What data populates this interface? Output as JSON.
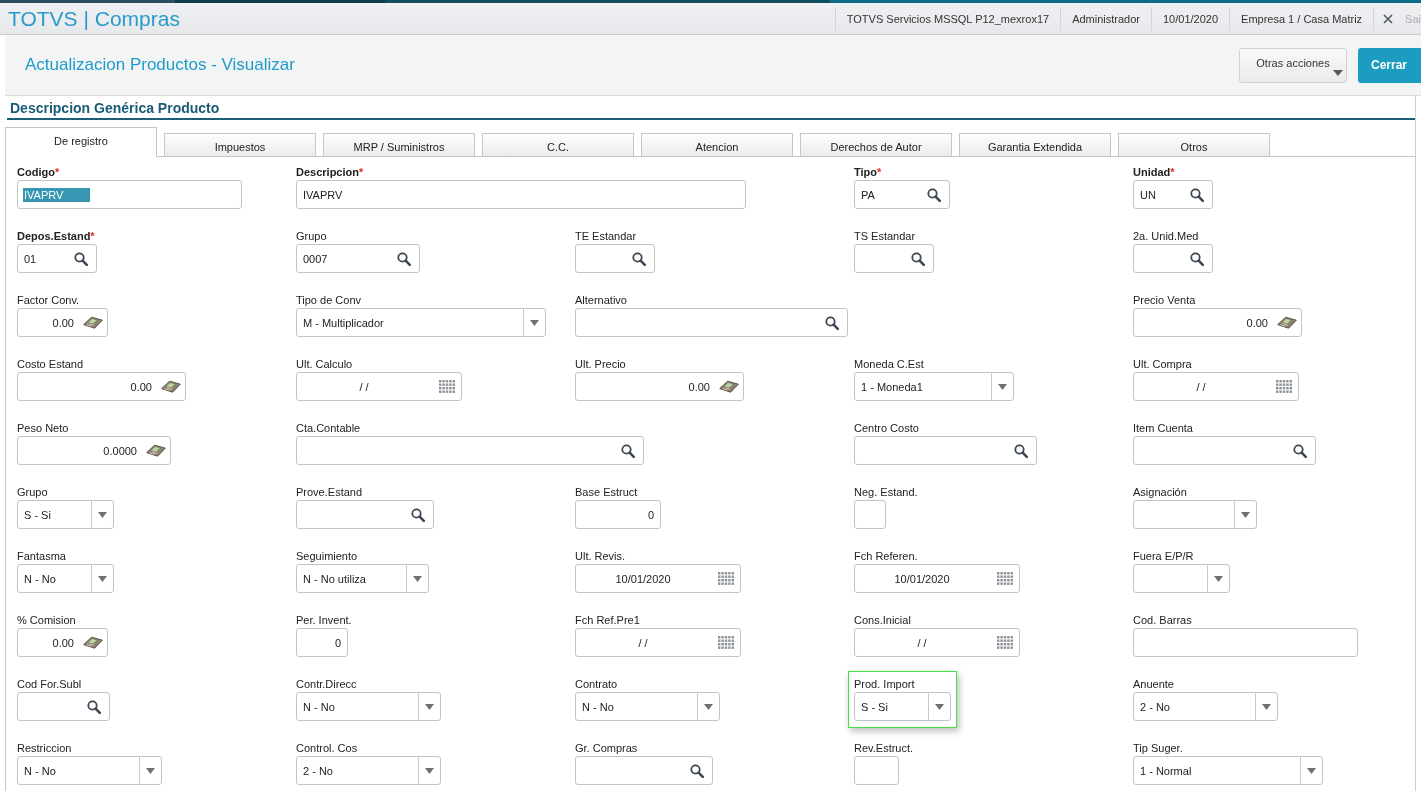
{
  "header": {
    "app_title": "TOTVS | Compras",
    "info": [
      "TOTVS Servicios MSSQL P12_mexrox17",
      "Administrador",
      "10/01/2020",
      "Empresa 1 / Casa Matriz"
    ],
    "exit_label": "Sai"
  },
  "toolbar": {
    "title": "Actualizacion Productos - Visualizar",
    "actions": [
      {
        "label": "Otras acciones",
        "kind": "menu"
      },
      {
        "label": "Cerrar",
        "kind": "primary"
      }
    ]
  },
  "section_title": "Descripcion Genérica Producto",
  "tabs": [
    {
      "label": "De registro",
      "selected": true
    },
    {
      "label": "Impuestos",
      "selected": false
    },
    {
      "label": "MRP / Suministros",
      "selected": false
    },
    {
      "label": "C.C.",
      "selected": false
    },
    {
      "label": "Atencion",
      "selected": false
    },
    {
      "label": "Derechos de Autor",
      "selected": false
    },
    {
      "label": "Garantia Extendida",
      "selected": false
    },
    {
      "label": "Otros",
      "selected": false
    }
  ],
  "form": {
    "rows": [
      [
        {
          "label": "Codigo",
          "required": true,
          "mark": "*",
          "kind": "text",
          "value": "IVAPRV",
          "value_selected": true,
          "focused": false
        },
        {
          "label": "Descripcion",
          "required": true,
          "mark": "*",
          "kind": "text",
          "value": "IVAPRV",
          "value_selected": false,
          "focused": false
        },
        null,
        {
          "label": "Tipo",
          "required": true,
          "mark": "*",
          "kind": "lookup",
          "value": "PA",
          "value_selected": false,
          "focused": false
        },
        {
          "label": "Unidad",
          "required": true,
          "mark": "*",
          "kind": "lookup",
          "value": "UN",
          "value_selected": false,
          "focused": false
        }
      ],
      [
        {
          "label": "Depos.Estand",
          "required": true,
          "mark": "*",
          "kind": "lookup",
          "value": "01",
          "value_selected": false,
          "focused": false
        },
        {
          "label": "Grupo",
          "required": false,
          "kind": "lookup",
          "value": "0007",
          "value_selected": false,
          "focused": false
        },
        {
          "label": "TE Estandar",
          "required": false,
          "kind": "lookup",
          "value_selected": false,
          "focused": false
        },
        {
          "label": "TS Estandar",
          "required": false,
          "kind": "lookup",
          "value_selected": false,
          "focused": false
        },
        {
          "label": "2a. Unid.Med",
          "required": false,
          "kind": "lookup",
          "value_selected": false,
          "focused": false
        }
      ],
      [
        {
          "label": "Factor Conv.",
          "required": false,
          "kind": "numeric",
          "value": "0.00",
          "value_selected": false,
          "focused": false
        },
        {
          "label": "Tipo de Conv",
          "required": false,
          "kind": "select",
          "value": "M - Multiplicador",
          "value_selected": false,
          "focused": false
        },
        {
          "label": "Alternativo",
          "required": false,
          "kind": "lookup",
          "value_selected": false,
          "focused": false
        },
        null,
        {
          "label": "Precio Venta",
          "required": false,
          "kind": "numeric",
          "value": "0.00",
          "value_selected": false,
          "focused": false
        }
      ],
      [
        {
          "label": "Costo Estand",
          "required": false,
          "kind": "numeric",
          "value": "0.00",
          "value_selected": false,
          "focused": false
        },
        {
          "label": "Ult. Calculo",
          "required": false,
          "kind": "date",
          "value": "/ /",
          "value_selected": false,
          "focused": false
        },
        {
          "label": "Ult. Precio",
          "required": false,
          "kind": "numeric",
          "value": "0.00",
          "value_selected": false,
          "focused": false
        },
        {
          "label": "Moneda C.Est",
          "required": false,
          "kind": "select",
          "value": "1 - Moneda1",
          "value_selected": false,
          "focused": false
        },
        {
          "label": "Ult. Compra",
          "required": false,
          "kind": "date",
          "value": "/ /",
          "value_selected": false,
          "focused": false
        }
      ],
      [
        {
          "label": "Peso Neto",
          "required": false,
          "kind": "numeric",
          "value": "0.0000",
          "value_selected": false,
          "focused": false
        },
        {
          "label": "Cta.Contable",
          "required": false,
          "kind": "lookup",
          "value_selected": false,
          "focused": false
        },
        null,
        {
          "label": "Centro Costo",
          "required": false,
          "kind": "lookup",
          "value_selected": false,
          "focused": false
        },
        {
          "label": "Item Cuenta",
          "required": false,
          "kind": "lookup",
          "value_selected": false,
          "focused": false
        }
      ],
      [
        {
          "label": "Grupo",
          "required": false,
          "kind": "select",
          "value": "S - Si",
          "value_selected": false,
          "focused": false
        },
        {
          "label": "Prove.Estand",
          "required": false,
          "kind": "lookup",
          "value_selected": false,
          "focused": false
        },
        {
          "label": "Base Estruct",
          "required": false,
          "kind": "number",
          "value": "0",
          "value_selected": false,
          "focused": false
        },
        {
          "label": "Neg. Estand.",
          "required": false,
          "kind": "text",
          "value_selected": false,
          "focused": false
        },
        {
          "label": "Asignación",
          "required": false,
          "kind": "select",
          "value_selected": false,
          "focused": false
        }
      ],
      [
        {
          "label": "Fantasma",
          "required": false,
          "kind": "select",
          "value": "N - No",
          "value_selected": false,
          "focused": false
        },
        {
          "label": "Seguimiento",
          "required": false,
          "kind": "select",
          "value": "N - No utiliza",
          "value_selected": false,
          "focused": false
        },
        {
          "label": "Ult. Revis.",
          "required": false,
          "kind": "date",
          "value": "10/01/2020",
          "value_selected": false,
          "focused": false
        },
        {
          "label": "Fch Referen.",
          "required": false,
          "kind": "date",
          "value": "10/01/2020",
          "value_selected": false,
          "focused": false
        },
        {
          "label": "Fuera E/P/R",
          "required": false,
          "kind": "select",
          "value_selected": false,
          "focused": false
        }
      ],
      [
        {
          "label": "% Comision",
          "required": false,
          "kind": "numeric",
          "value": "0.00",
          "value_selected": false,
          "focused": false
        },
        {
          "label": "Per. Invent.",
          "required": false,
          "kind": "number",
          "value": "0",
          "value_selected": false,
          "focused": false
        },
        {
          "label": "Fch Ref.Pre1",
          "required": false,
          "kind": "date",
          "value": "/ /",
          "value_selected": false,
          "focused": false
        },
        {
          "label": "Cons.Inicial",
          "required": false,
          "kind": "date",
          "value": "/ /",
          "value_selected": false,
          "focused": false
        },
        {
          "label": "Cod. Barras",
          "required": false,
          "kind": "text",
          "value_selected": false,
          "focused": false
        }
      ],
      [
        {
          "label": "Cod For.Subl",
          "required": false,
          "kind": "lookup",
          "value_selected": false,
          "focused": false
        },
        {
          "label": "Contr.Direcc",
          "required": false,
          "kind": "select",
          "value": "N - No",
          "value_selected": false,
          "focused": false
        },
        {
          "label": "Contrato",
          "required": false,
          "kind": "select",
          "value": "N - No",
          "value_selected": false,
          "focused": false
        },
        {
          "label": "Prod. Import",
          "required": false,
          "kind": "select",
          "value": "S - Si",
          "value_selected": false,
          "focused": true
        },
        {
          "label": "Anuente",
          "required": false,
          "kind": "select",
          "value": "2 - No",
          "value_selected": false,
          "focused": false
        }
      ],
      [
        {
          "label": "Restriccion",
          "required": false,
          "kind": "select",
          "value": "N - No",
          "value_selected": false,
          "focused": false
        },
        {
          "label": "Control. Cos",
          "required": false,
          "kind": "select",
          "value": "2 - No",
          "value_selected": false,
          "focused": false
        },
        {
          "label": "Gr. Compras",
          "required": false,
          "kind": "lookup",
          "value_selected": false,
          "focused": false
        },
        {
          "label": "Rev.Estruct.",
          "required": false,
          "kind": "text",
          "value_selected": false,
          "focused": false
        },
        {
          "label": "Tip Suger.",
          "required": false,
          "kind": "select",
          "value": "1 - Normal",
          "value_selected": false,
          "focused": false
        }
      ]
    ]
  }
}
